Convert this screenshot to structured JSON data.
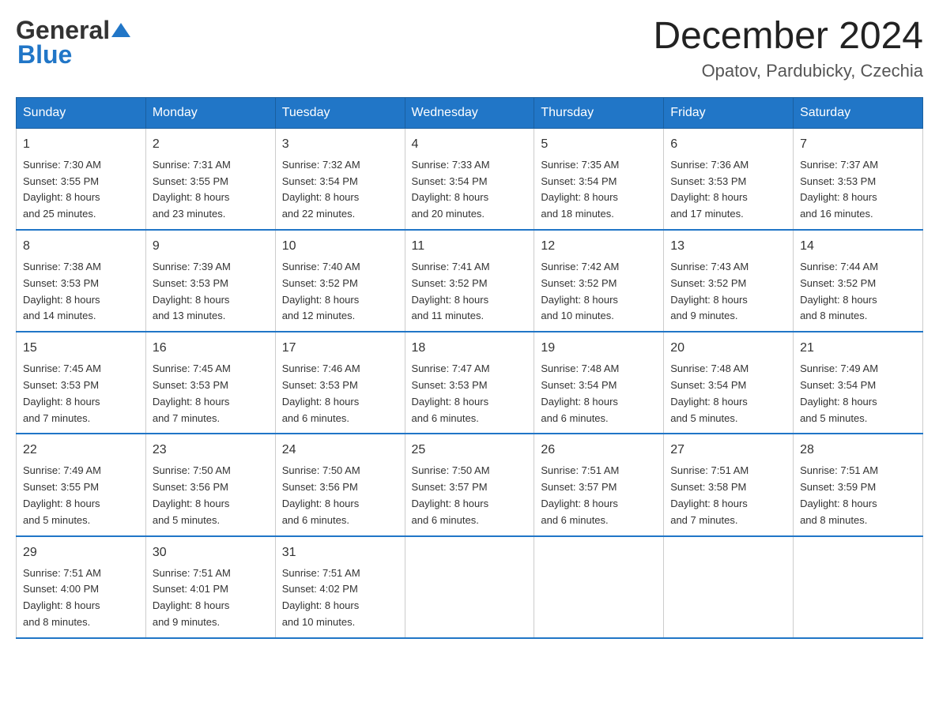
{
  "header": {
    "month_title": "December 2024",
    "location": "Opatov, Pardubicky, Czechia"
  },
  "days_of_week": [
    "Sunday",
    "Monday",
    "Tuesday",
    "Wednesday",
    "Thursday",
    "Friday",
    "Saturday"
  ],
  "weeks": [
    [
      {
        "day": "1",
        "sunrise": "7:30 AM",
        "sunset": "3:55 PM",
        "daylight": "8 hours and 25 minutes."
      },
      {
        "day": "2",
        "sunrise": "7:31 AM",
        "sunset": "3:55 PM",
        "daylight": "8 hours and 23 minutes."
      },
      {
        "day": "3",
        "sunrise": "7:32 AM",
        "sunset": "3:54 PM",
        "daylight": "8 hours and 22 minutes."
      },
      {
        "day": "4",
        "sunrise": "7:33 AM",
        "sunset": "3:54 PM",
        "daylight": "8 hours and 20 minutes."
      },
      {
        "day": "5",
        "sunrise": "7:35 AM",
        "sunset": "3:54 PM",
        "daylight": "8 hours and 18 minutes."
      },
      {
        "day": "6",
        "sunrise": "7:36 AM",
        "sunset": "3:53 PM",
        "daylight": "8 hours and 17 minutes."
      },
      {
        "day": "7",
        "sunrise": "7:37 AM",
        "sunset": "3:53 PM",
        "daylight": "8 hours and 16 minutes."
      }
    ],
    [
      {
        "day": "8",
        "sunrise": "7:38 AM",
        "sunset": "3:53 PM",
        "daylight": "8 hours and 14 minutes."
      },
      {
        "day": "9",
        "sunrise": "7:39 AM",
        "sunset": "3:53 PM",
        "daylight": "8 hours and 13 minutes."
      },
      {
        "day": "10",
        "sunrise": "7:40 AM",
        "sunset": "3:52 PM",
        "daylight": "8 hours and 12 minutes."
      },
      {
        "day": "11",
        "sunrise": "7:41 AM",
        "sunset": "3:52 PM",
        "daylight": "8 hours and 11 minutes."
      },
      {
        "day": "12",
        "sunrise": "7:42 AM",
        "sunset": "3:52 PM",
        "daylight": "8 hours and 10 minutes."
      },
      {
        "day": "13",
        "sunrise": "7:43 AM",
        "sunset": "3:52 PM",
        "daylight": "8 hours and 9 minutes."
      },
      {
        "day": "14",
        "sunrise": "7:44 AM",
        "sunset": "3:52 PM",
        "daylight": "8 hours and 8 minutes."
      }
    ],
    [
      {
        "day": "15",
        "sunrise": "7:45 AM",
        "sunset": "3:53 PM",
        "daylight": "8 hours and 7 minutes."
      },
      {
        "day": "16",
        "sunrise": "7:45 AM",
        "sunset": "3:53 PM",
        "daylight": "8 hours and 7 minutes."
      },
      {
        "day": "17",
        "sunrise": "7:46 AM",
        "sunset": "3:53 PM",
        "daylight": "8 hours and 6 minutes."
      },
      {
        "day": "18",
        "sunrise": "7:47 AM",
        "sunset": "3:53 PM",
        "daylight": "8 hours and 6 minutes."
      },
      {
        "day": "19",
        "sunrise": "7:48 AM",
        "sunset": "3:54 PM",
        "daylight": "8 hours and 6 minutes."
      },
      {
        "day": "20",
        "sunrise": "7:48 AM",
        "sunset": "3:54 PM",
        "daylight": "8 hours and 5 minutes."
      },
      {
        "day": "21",
        "sunrise": "7:49 AM",
        "sunset": "3:54 PM",
        "daylight": "8 hours and 5 minutes."
      }
    ],
    [
      {
        "day": "22",
        "sunrise": "7:49 AM",
        "sunset": "3:55 PM",
        "daylight": "8 hours and 5 minutes."
      },
      {
        "day": "23",
        "sunrise": "7:50 AM",
        "sunset": "3:56 PM",
        "daylight": "8 hours and 5 minutes."
      },
      {
        "day": "24",
        "sunrise": "7:50 AM",
        "sunset": "3:56 PM",
        "daylight": "8 hours and 6 minutes."
      },
      {
        "day": "25",
        "sunrise": "7:50 AM",
        "sunset": "3:57 PM",
        "daylight": "8 hours and 6 minutes."
      },
      {
        "day": "26",
        "sunrise": "7:51 AM",
        "sunset": "3:57 PM",
        "daylight": "8 hours and 6 minutes."
      },
      {
        "day": "27",
        "sunrise": "7:51 AM",
        "sunset": "3:58 PM",
        "daylight": "8 hours and 7 minutes."
      },
      {
        "day": "28",
        "sunrise": "7:51 AM",
        "sunset": "3:59 PM",
        "daylight": "8 hours and 8 minutes."
      }
    ],
    [
      {
        "day": "29",
        "sunrise": "7:51 AM",
        "sunset": "4:00 PM",
        "daylight": "8 hours and 8 minutes."
      },
      {
        "day": "30",
        "sunrise": "7:51 AM",
        "sunset": "4:01 PM",
        "daylight": "8 hours and 9 minutes."
      },
      {
        "day": "31",
        "sunrise": "7:51 AM",
        "sunset": "4:02 PM",
        "daylight": "8 hours and 10 minutes."
      },
      null,
      null,
      null,
      null
    ]
  ],
  "labels": {
    "sunrise": "Sunrise:",
    "sunset": "Sunset:",
    "daylight": "Daylight:"
  }
}
